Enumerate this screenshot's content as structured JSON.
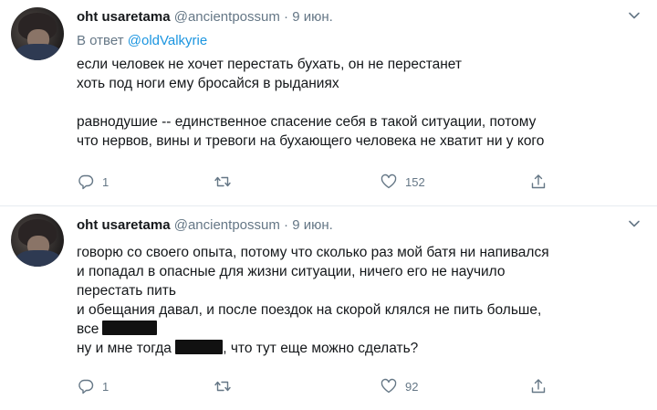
{
  "tweets": [
    {
      "name": "oht usaretama",
      "handle": "@ancientpossum",
      "separator": "·",
      "date": "9 июн.",
      "reply_prefix": "В ответ",
      "reply_mention": "@oldValkyrie",
      "lines": [
        "если человек не хочет перестать бухать, он не перестанет",
        "хоть под ноги ему бросайся в рыданиях",
        "равнодушие -- единственное спасение себя в такой ситуации, потому",
        "что нервов, вины и тревоги на бухающего человека не хватит ни у кого"
      ],
      "reply_count": "1",
      "retweet_count": "",
      "like_count": "152"
    },
    {
      "name": "oht usaretama",
      "handle": "@ancientpossum",
      "separator": "·",
      "date": "9 июн.",
      "lines": [
        "говорю со своего опыта, потому что сколько раз мой батя ни напивался",
        "и попадал в опасные для жизни ситуации, ничего его не научило",
        "перестать пить",
        "и обещания давал, и после поездок на скорой клялся не пить больше,",
        "все",
        "ну и мне тогда",
        ", что тут еще можно сделать?"
      ],
      "reply_count": "1",
      "retweet_count": "",
      "like_count": "92"
    }
  ],
  "icons": {
    "reply": "reply-icon",
    "retweet": "retweet-icon",
    "like": "heart-icon",
    "share": "share-icon",
    "caret": "chevron-down-icon"
  },
  "colors": {
    "text": "#14171a",
    "secondary": "#657786",
    "link": "#1b95e0",
    "divider": "#e6ecf0"
  }
}
